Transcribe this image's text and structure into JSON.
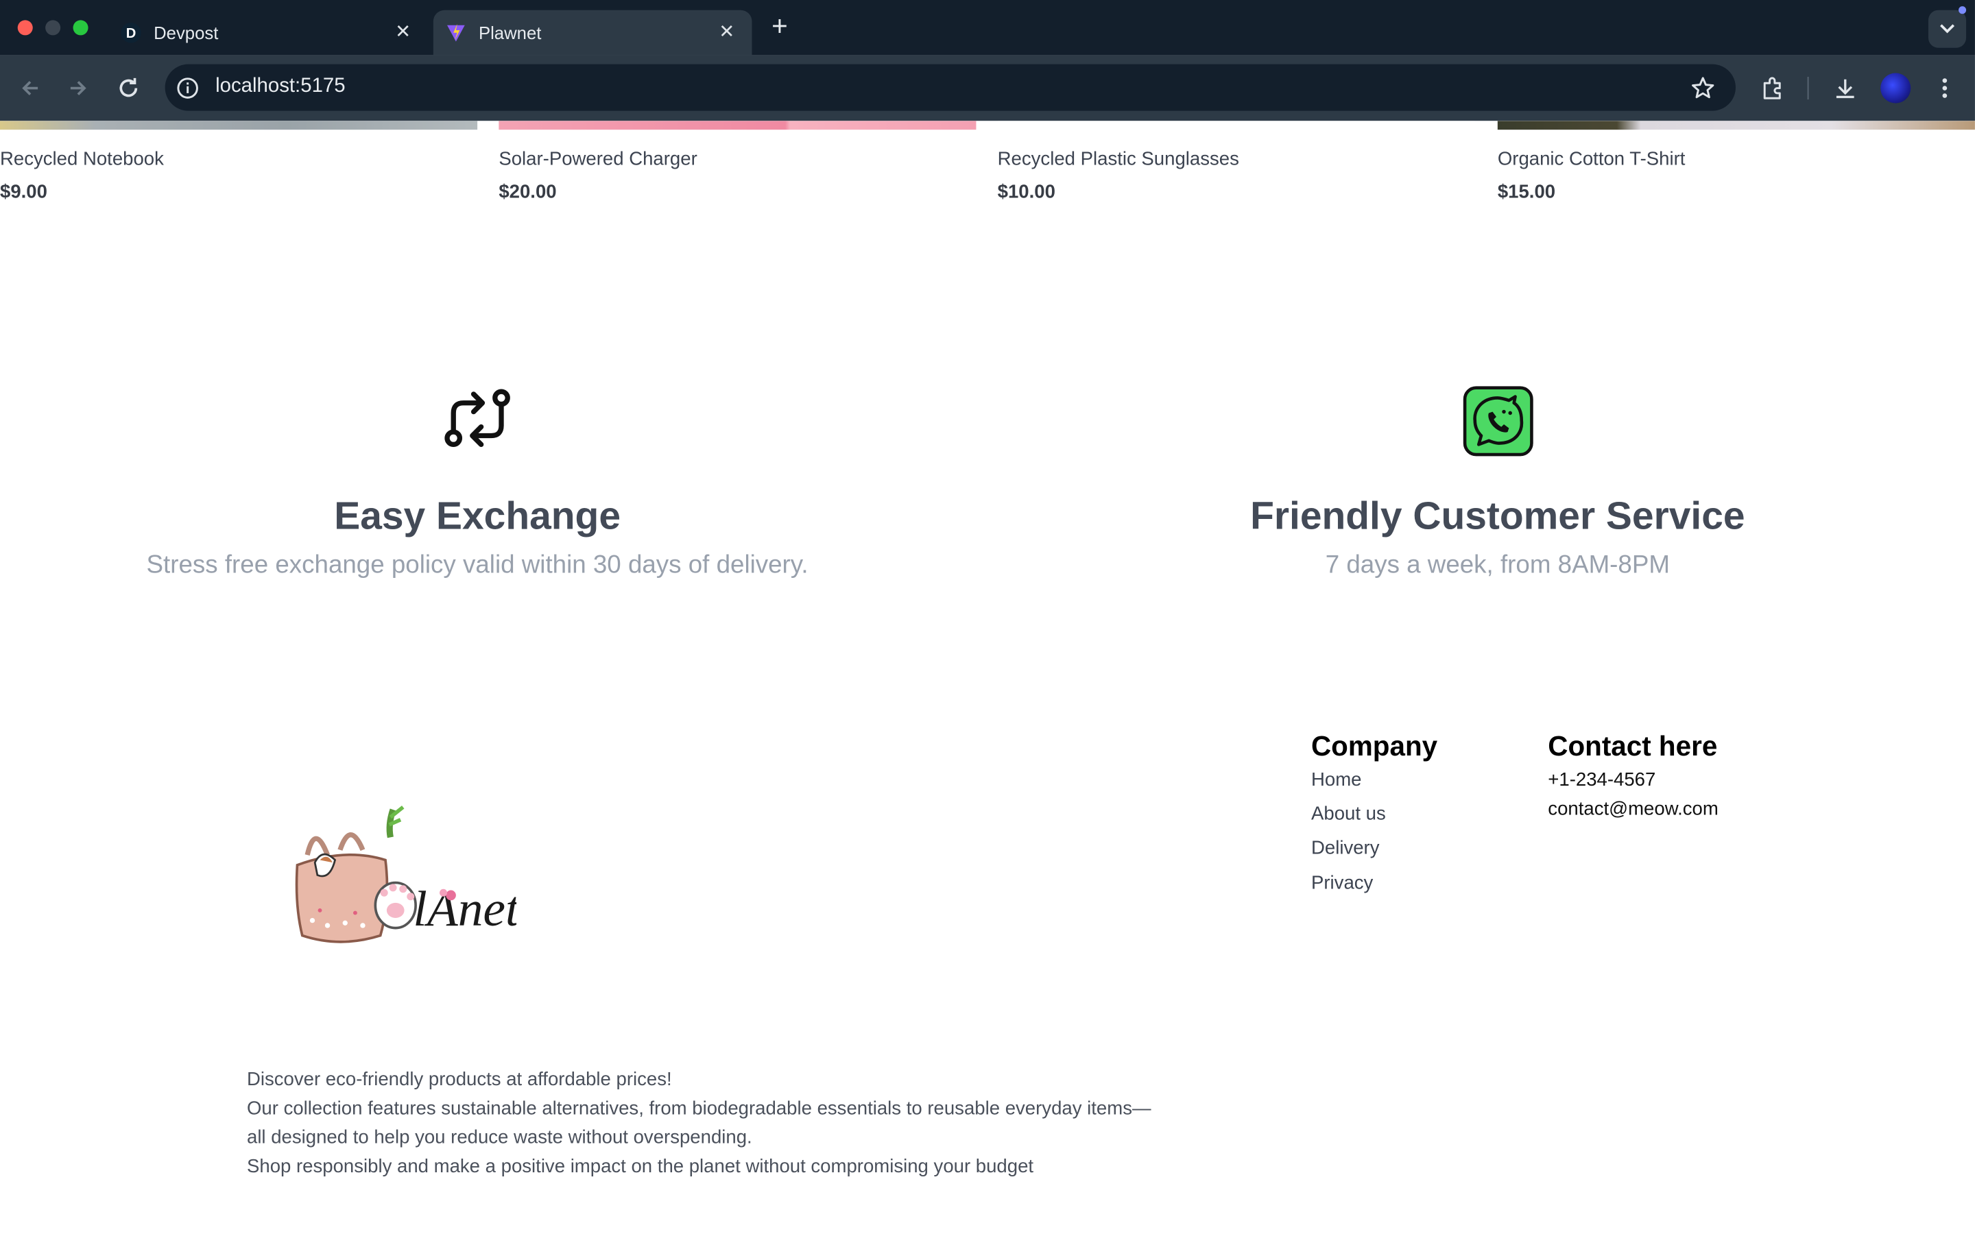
{
  "browser": {
    "tabs": [
      {
        "title": "Devpost",
        "favicon": "devpost-d-icon"
      },
      {
        "title": "Plawnet",
        "favicon": "vite-logo-icon"
      }
    ],
    "url": "localhost:5175"
  },
  "products": [
    {
      "name": "Recycled Notebook",
      "price": "$9.00"
    },
    {
      "name": "Solar-Powered Charger",
      "price": "$20.00"
    },
    {
      "name": "Recycled Plastic Sunglasses",
      "price": "$10.00"
    },
    {
      "name": "Organic Cotton T-Shirt",
      "price": "$15.00"
    }
  ],
  "features": [
    {
      "icon": "exchange-arrows-icon",
      "title": "Easy Exchange",
      "subtitle": "Stress free exchange policy valid within 30 days of delivery."
    },
    {
      "icon": "cat-phone-chat-icon",
      "title": "Friendly Customer Service",
      "subtitle": "7 days a week, from 8AM-8PM"
    }
  ],
  "footer": {
    "logo_text": "lAnet",
    "company": {
      "title": "Company",
      "links": [
        "Home",
        "About us",
        "Delivery",
        "Privacy"
      ]
    },
    "contact": {
      "title": "Contact here",
      "phone": "+1-234-4567",
      "email": "contact@meow.com"
    },
    "about_lines": [
      "Discover eco-friendly products at affordable prices!",
      "Our collection features sustainable alternatives, from biodegradable essentials to reusable everyday items—all designed to help you reduce waste without overspending.",
      "Shop responsibly and make a positive impact on the planet without compromising your budget"
    ]
  },
  "colors": {
    "chrome_dark": "#131f2c",
    "chrome_mid": "#2d3a46",
    "whatsapp_green": "#4cd964"
  }
}
